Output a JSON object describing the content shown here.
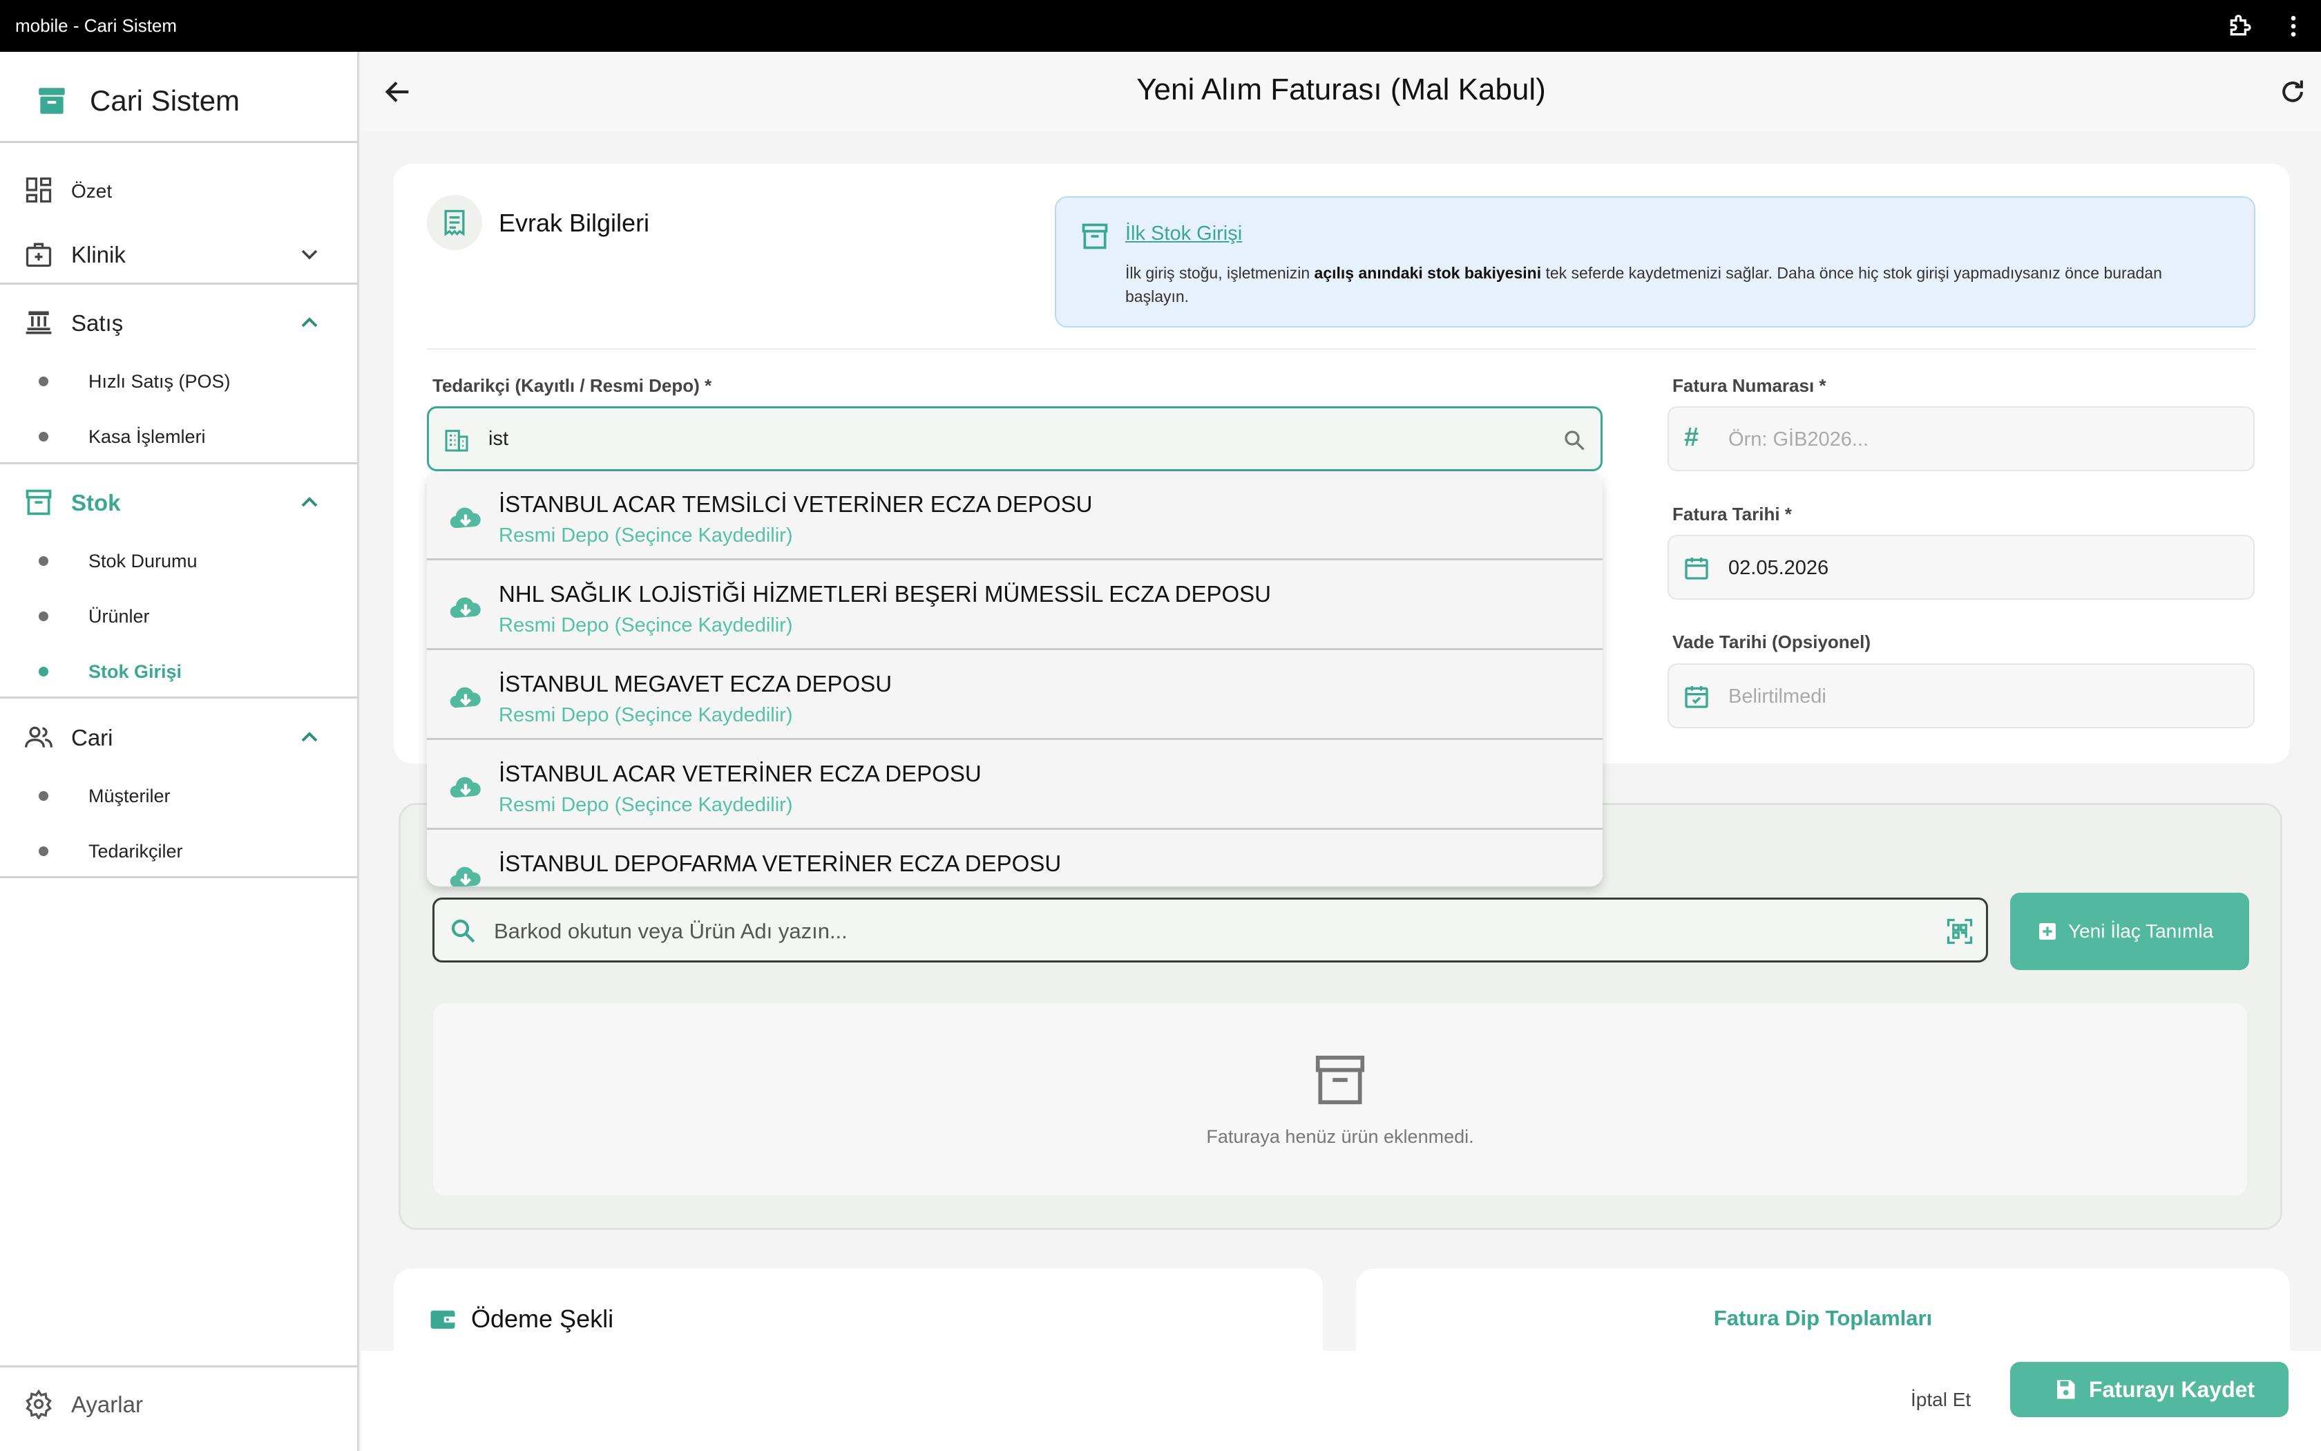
{
  "window": {
    "title": "mobile - Cari Sistem"
  },
  "sidebar": {
    "brand": "Cari Sistem",
    "items": {
      "ozet": "Özet",
      "klinik": "Klinik",
      "satis": "Satış",
      "satis_sub": [
        "Hızlı Satış (POS)",
        "Kasa İşlemleri"
      ],
      "stok": "Stok",
      "stok_sub": [
        "Stok Durumu",
        "Ürünler",
        "Stok Girişi"
      ],
      "cari": "Cari",
      "cari_sub": [
        "Müşteriler",
        "Tedarikçiler"
      ],
      "ayarlar": "Ayarlar"
    }
  },
  "header": {
    "title": "Yeni Alım Faturası (Mal Kabul)"
  },
  "evrak": {
    "title": "Evrak Bilgileri",
    "info_link": "İlk Stok Girişi",
    "info_desc_1": "İlk giriş stoğu, işletmenizin ",
    "info_desc_bold": "açılış anındaki stok bakiyesini",
    "info_desc_2": " tek seferde kaydetmenizi sağlar. Daha önce hiç stok girişi yapmadıysanız önce buradan başlayın.",
    "supplier_label": "Tedarikçi (Kayıtlı / Resmi Depo) *",
    "supplier_value": "ist",
    "invoice_no_label": "Fatura Numarası *",
    "invoice_no_placeholder": "Örn: GİB2026...",
    "invoice_date_label": "Fatura Tarihi *",
    "invoice_date_value": "02.05.2026",
    "due_date_label": "Vade Tarihi (Opsiyonel)",
    "due_date_placeholder": "Belirtilmedi"
  },
  "suggestions": [
    {
      "name": "İSTANBUL ACAR TEMSİLCİ VETERİNER ECZA DEPOSU",
      "sub": "Resmi Depo (Seçince Kaydedilir)"
    },
    {
      "name": "NHL SAĞLIK LOJİSTİĞİ HİZMETLERİ BEŞERİ MÜMESSİL ECZA DEPOSU",
      "sub": "Resmi Depo (Seçince Kaydedilir)"
    },
    {
      "name": "İSTANBUL MEGAVET ECZA DEPOSU",
      "sub": "Resmi Depo (Seçince Kaydedilir)"
    },
    {
      "name": "İSTANBUL ACAR VETERİNER ECZA DEPOSU",
      "sub": "Resmi Depo (Seçince Kaydedilir)"
    },
    {
      "name": "İSTANBUL DEPOFARMA VETERİNER ECZA DEPOSU",
      "sub": ""
    }
  ],
  "products": {
    "barcode_placeholder": "Barkod okutun veya Ürün Adı yazın...",
    "new_drug_button": "Yeni İlaç Tanımla",
    "empty_message": "Faturaya henüz ürün eklenmedi."
  },
  "payment": {
    "title": "Ödeme Şekli"
  },
  "totals": {
    "title": "Fatura Dip Toplamları"
  },
  "footer": {
    "cancel": "İptal Et",
    "save": "Faturayı Kaydet"
  },
  "colors": {
    "accent": "#3aa892",
    "accent_light": "#52b99e",
    "info_bg": "#e6f1fb"
  }
}
